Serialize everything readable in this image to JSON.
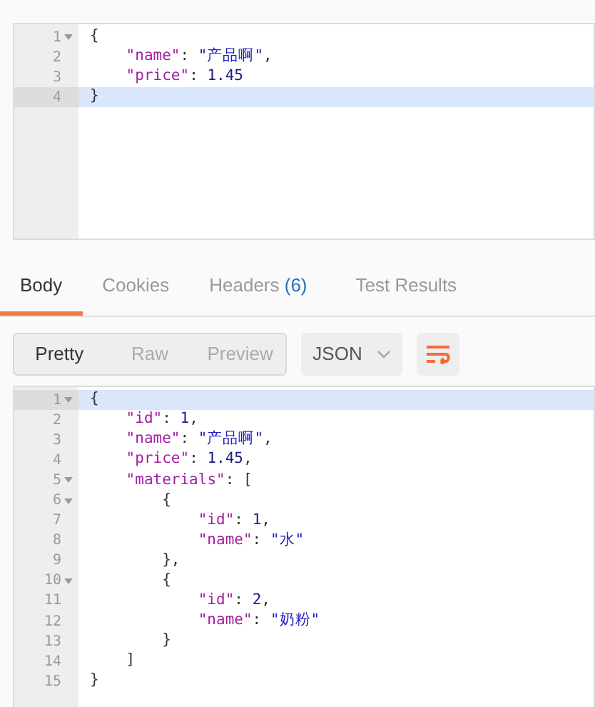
{
  "request_editor": {
    "lines": [
      {
        "number": "1",
        "foldable": true,
        "highlighted": false,
        "text": "{"
      },
      {
        "number": "2",
        "foldable": false,
        "highlighted": false,
        "text": "    \"name\": \"产品啊\","
      },
      {
        "number": "3",
        "foldable": false,
        "highlighted": false,
        "text": "    \"price\": 1.45"
      },
      {
        "number": "4",
        "foldable": false,
        "highlighted": true,
        "text": "}"
      }
    ]
  },
  "response_tabs": [
    {
      "label": "Body",
      "selected": true
    },
    {
      "label": "Cookies",
      "selected": false
    },
    {
      "label": "Headers",
      "count": "(6)",
      "selected": false
    },
    {
      "label": "Test Results",
      "selected": false
    }
  ],
  "view_modes": [
    {
      "label": "Pretty",
      "selected": true
    },
    {
      "label": "Raw",
      "selected": false
    },
    {
      "label": "Preview",
      "selected": false
    }
  ],
  "format_select": {
    "value": "JSON"
  },
  "response_editor": {
    "lines": [
      {
        "number": "1",
        "foldable": true,
        "highlighted": true,
        "text": "{"
      },
      {
        "number": "2",
        "foldable": false,
        "highlighted": false,
        "text": "    \"id\": 1,"
      },
      {
        "number": "3",
        "foldable": false,
        "highlighted": false,
        "text": "    \"name\": \"产品啊\","
      },
      {
        "number": "4",
        "foldable": false,
        "highlighted": false,
        "text": "    \"price\": 1.45,"
      },
      {
        "number": "5",
        "foldable": true,
        "highlighted": false,
        "text": "    \"materials\": ["
      },
      {
        "number": "6",
        "foldable": true,
        "highlighted": false,
        "text": "        {"
      },
      {
        "number": "7",
        "foldable": false,
        "highlighted": false,
        "text": "            \"id\": 1,"
      },
      {
        "number": "8",
        "foldable": false,
        "highlighted": false,
        "text": "            \"name\": \"水\""
      },
      {
        "number": "9",
        "foldable": false,
        "highlighted": false,
        "text": "        },"
      },
      {
        "number": "10",
        "foldable": true,
        "highlighted": false,
        "text": "        {"
      },
      {
        "number": "11",
        "foldable": false,
        "highlighted": false,
        "text": "            \"id\": 2,"
      },
      {
        "number": "12",
        "foldable": false,
        "highlighted": false,
        "text": "            \"name\": \"奶粉\""
      },
      {
        "number": "13",
        "foldable": false,
        "highlighted": false,
        "text": "        }"
      },
      {
        "number": "14",
        "foldable": false,
        "highlighted": false,
        "text": "    ]"
      },
      {
        "number": "15",
        "foldable": false,
        "highlighted": false,
        "text": "}"
      }
    ]
  }
}
